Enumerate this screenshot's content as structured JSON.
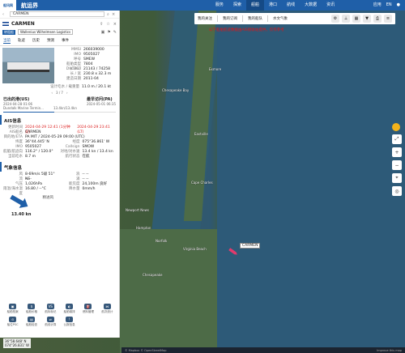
{
  "app": {
    "logo_text": "船讯网",
    "title": "航运界"
  },
  "nav": {
    "items": [
      "服务",
      "探索",
      "船舶",
      "港口",
      "航线",
      "大数据",
      "资讯"
    ],
    "active_index": 2,
    "right": [
      "应用",
      "EN"
    ]
  },
  "panel": {
    "search_value": "CARMEN",
    "ship_name": "CARMEN",
    "tag": "转租船",
    "owner": "Wallenius Wilhelmsen Logistics",
    "tabs": [
      "当前",
      "轨迹",
      "历史",
      "预测",
      "事件"
    ],
    "info": [
      {
        "k": "MMSI",
        "v": "266039000"
      },
      {
        "k": "IMO",
        "v": "9505027"
      },
      {
        "k": "呼号",
        "v": "SMEW"
      },
      {
        "k": "船舶类型(CBIL)",
        "v": "7804"
      },
      {
        "k": "DWT/GT",
        "v": "21143 / 74258"
      },
      {
        "k": "长 / 宽",
        "v": "230.8 x 32.3 m"
      },
      {
        "k": "建造日期",
        "v": "2011-04"
      },
      {
        "k": "设计吃水 / 载重量",
        "v": "11.0 m / 20.1 kt"
      }
    ],
    "pager": "3 / 7",
    "voyage": {
      "last_port_label": "已出的港(US)",
      "last_port_time": "2024-04-28 01:06",
      "last_port_name": "Dundalk Marine Termin...",
      "speed": "13.4kn/13.4kn",
      "next_port_label": "最早访问(PA)",
      "next_port_time": "2024-05-01 06:35"
    },
    "progress": 0.45,
    "ais": {
      "title": "AIS信息",
      "updated_label": "更新时间",
      "updated_value": "2024-04-29 12:41 (1分钟前)",
      "updated_value2": "2024-04-29 23:41 (LT)",
      "ais_name_label": "AIS船名",
      "ais_name": "CARMEN",
      "dest_label": "目的地/ETA",
      "dest_value": "PA MIT / 2024-05-29 09:00 (UTC)",
      "rows": [
        {
          "k": "纬度",
          "v": "36°44.445' N",
          "k2": "经度",
          "v2": "075°36.861' W"
        },
        {
          "k": "IMO",
          "v": "9505027",
          "k2": "Callsign",
          "v2": "SMOW"
        },
        {
          "k": "航艏/航迹向",
          "v": "116.2° / 120.0°",
          "k2": "对地/对水速",
          "v2": "13.4 kn / 13.4 kn"
        },
        {
          "k": "当前吃水",
          "v": "8.7 m",
          "k2": "航行状态",
          "v2": "在航"
        }
      ]
    },
    "weather": {
      "title": "气象信息",
      "rows": [
        {
          "k": "风",
          "v": "8-69m/s 5级 51° NE",
          "k2": "浪",
          "v2": "-- --"
        },
        {
          "k": "流",
          "v": "-- --",
          "k2": "涌",
          "v2": "-- --"
        },
        {
          "k": "气压",
          "v": "1,026hPa",
          "k2": "能见度",
          "v2": "24,100m 良好"
        },
        {
          "k": "雨温/海水温度",
          "v": "16.80 / --°C",
          "k2": "降水量",
          "v2": "0mm/h"
        }
      ],
      "speed": "13.40 kn",
      "badge": "精进风"
    },
    "bottom_icons": [
      "船舶档案",
      "船舶价格",
      "航标标记",
      "船舶碳排",
      "燃料管理",
      "航次统计",
      "船位PSC",
      "船舶检查",
      "航线计算",
      "公报信息"
    ]
  },
  "map": {
    "toolbar": [
      "我的关注",
      "我的订阅",
      "我的船队",
      "水文气象"
    ],
    "notice": "以下船舶航迹数据由AIS接收站提供，仅作参考",
    "ship_label": "CARMEN",
    "places": [
      "Chesapeake Bay",
      "Newport News",
      "Norfolk",
      "Virginia Beach",
      "Chesapeake",
      "Hampton",
      "Cape Charles",
      "Eastville",
      "Exmore"
    ],
    "coords": [
      "36°58.648' N",
      "074°26.831' W"
    ],
    "scale": "5 km",
    "footer_left": "© Mapbox © OpenStreetMap",
    "footer_right": "Improve this map"
  },
  "colors": {
    "primary": "#1f5fa8",
    "ship_marker": "#e13a6c",
    "notice": "#e11111"
  },
  "icons": [
    "search-icon",
    "share-icon",
    "star-icon",
    "close-icon",
    "flag-icon",
    "edit-icon",
    "layers-icon",
    "zoom-in-icon",
    "zoom-out-icon",
    "sun-icon"
  ]
}
